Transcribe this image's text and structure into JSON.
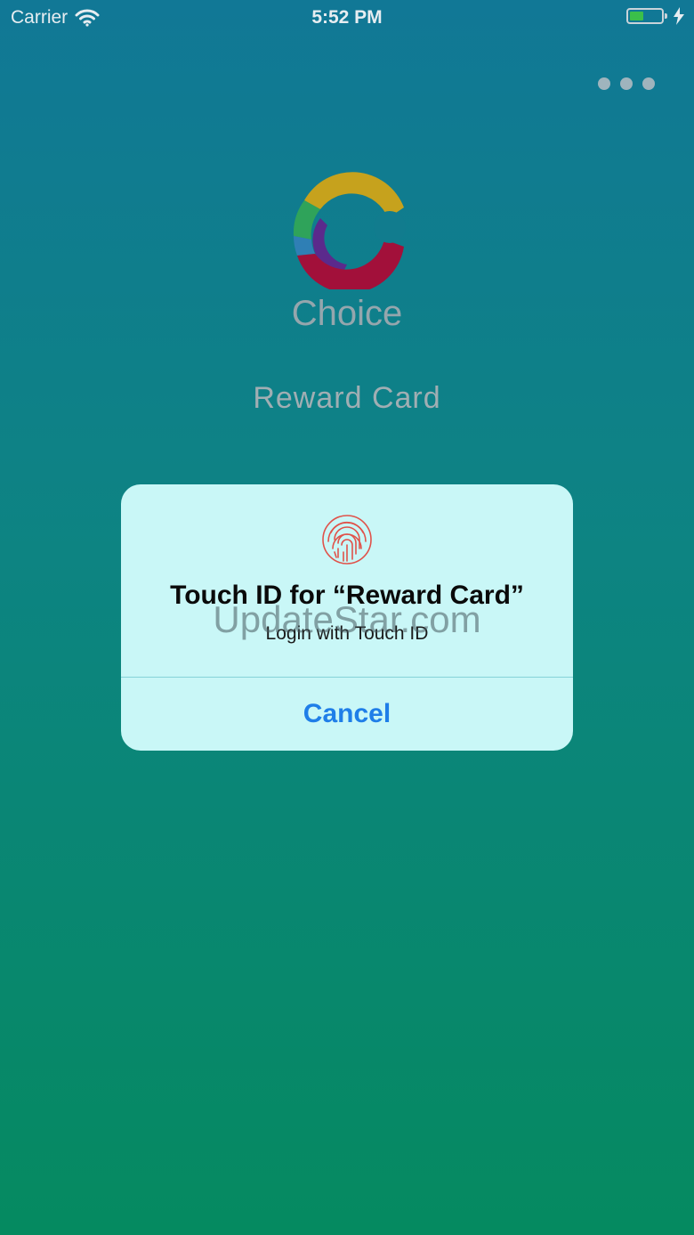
{
  "status_bar": {
    "carrier": "Carrier",
    "time": "5:52 PM",
    "battery_level": 0.45,
    "icons": [
      "wifi-icon",
      "battery-icon",
      "charging-bolt-icon"
    ]
  },
  "header": {
    "menu_icon": "more-dots-icon"
  },
  "logo": {
    "text": "Choice",
    "colors": [
      "#c6a21d",
      "#2fa35a",
      "#2f7fb5",
      "#5b2a8c",
      "#a2103a"
    ]
  },
  "app": {
    "title": "Reward Card"
  },
  "dialog": {
    "icon": "fingerprint-icon",
    "title": "Touch ID for “Reward Card”",
    "subtitle": "Login with Touch ID",
    "cancel_label": "Cancel",
    "accent_color": "#1f7ee8",
    "fingerprint_color": "#e0524a",
    "watermark": "UpdateStar.com"
  }
}
